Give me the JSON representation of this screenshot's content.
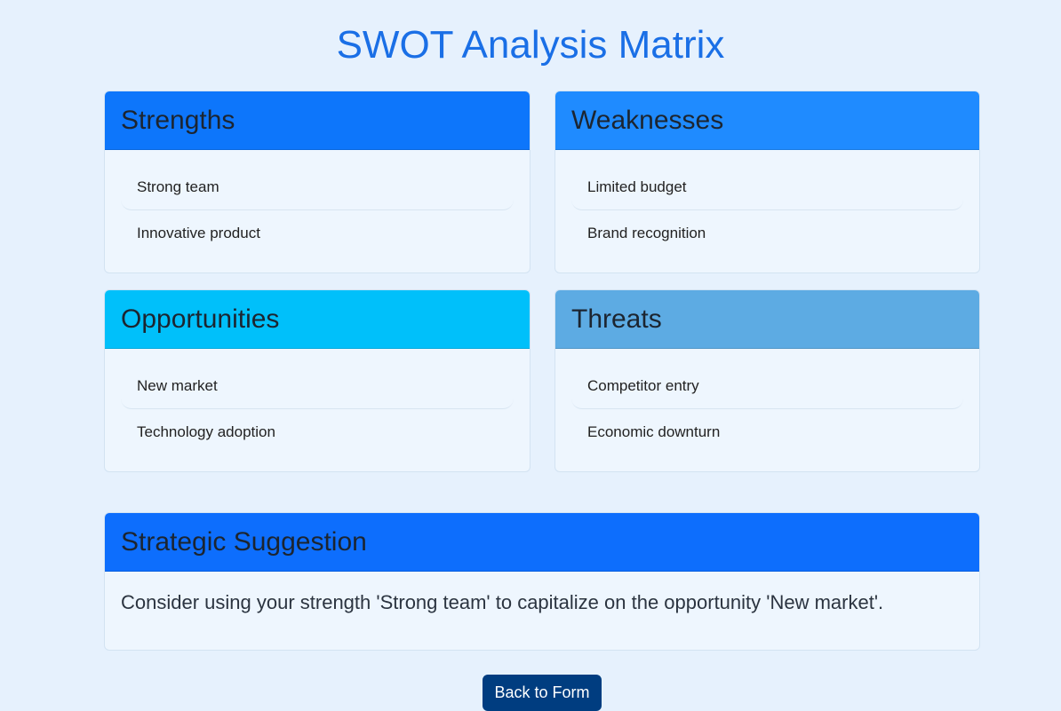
{
  "page": {
    "title": "SWOT Analysis Matrix"
  },
  "swot": {
    "strengths": {
      "title": "Strengths",
      "items": [
        "Strong team",
        "Innovative product"
      ]
    },
    "weaknesses": {
      "title": "Weaknesses",
      "items": [
        "Limited budget",
        "Brand recognition"
      ]
    },
    "opportunities": {
      "title": "Opportunities",
      "items": [
        "New market",
        "Technology adoption"
      ]
    },
    "threats": {
      "title": "Threats",
      "items": [
        "Competitor entry",
        "Economic downturn"
      ]
    }
  },
  "strategy": {
    "title": "Strategic Suggestion",
    "text": "Consider using your strength 'Strong team' to capitalize on the opportunity 'New market'."
  },
  "actions": {
    "back_label": "Back to Form"
  },
  "colors": {
    "page_background": "#e6f1fd",
    "title": "#1a6fe6",
    "strengths_header": "#0d76fb",
    "weaknesses_header": "#1f8bff",
    "opportunities_header": "#00c0fa",
    "threats_header": "#5dabe3",
    "strategy_header": "#0d6efd",
    "back_button": "#003d80"
  }
}
